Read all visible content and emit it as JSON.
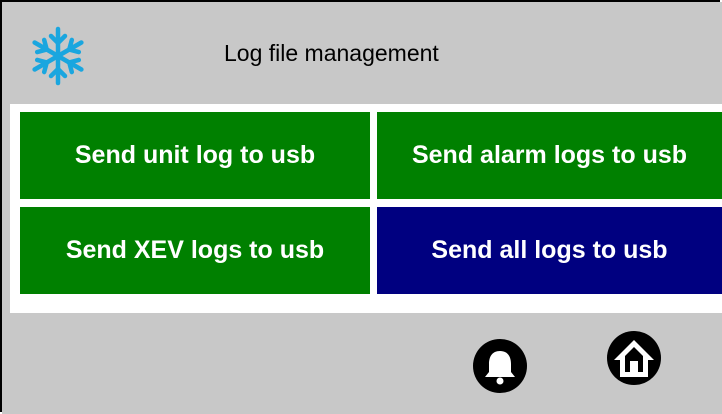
{
  "header": {
    "title": "Log file management",
    "logo_icon": "snowflake-icon",
    "logo_color": "#1aa6df"
  },
  "buttons": [
    {
      "label": "Send unit log to usb",
      "color": "#008000"
    },
    {
      "label": "Send alarm logs to usb",
      "color": "#008000"
    },
    {
      "label": "Send XEV logs to usb",
      "color": "#008000"
    },
    {
      "label": "Send all logs to usb",
      "color": "#000080"
    }
  ],
  "footer": {
    "icons": [
      "bell-icon",
      "home-icon"
    ]
  }
}
